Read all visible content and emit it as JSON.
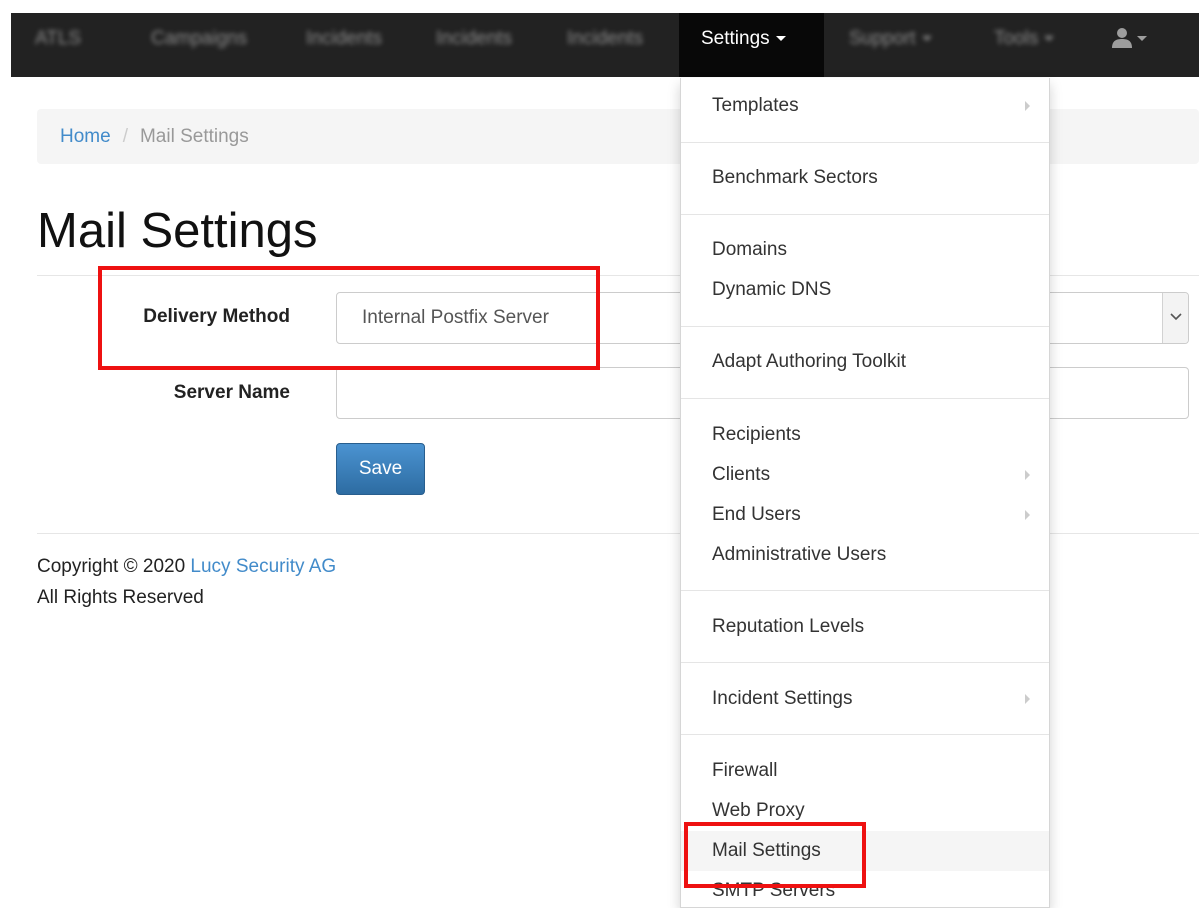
{
  "navbar": {
    "brand": "ATLS",
    "items": [
      {
        "label": "Campaigns"
      },
      {
        "label": "Incidents"
      },
      {
        "label": "Incidents"
      },
      {
        "label": "Incidents"
      }
    ],
    "active_menu": "Settings",
    "support_menu": "Support",
    "tools_menu": "Tools",
    "user_icon": "user-icon"
  },
  "breadcrumb": {
    "home": "Home",
    "separator": "/",
    "current": "Mail Settings"
  },
  "page": {
    "title": "Mail Settings"
  },
  "form": {
    "delivery_method_label": "Delivery Method",
    "delivery_method_value": "Internal Postfix Server",
    "server_name_label": "Server Name",
    "server_name_value": "",
    "save_label": "Save"
  },
  "footer": {
    "copyright_prefix": "Copyright © 2020",
    "company": "Lucy Security AG",
    "rights": "All Rights Reserved"
  },
  "settings_menu": {
    "groups": [
      [
        {
          "label": "Templates",
          "submenu": true
        }
      ],
      [
        {
          "label": "Benchmark Sectors",
          "submenu": false
        }
      ],
      [
        {
          "label": "Domains",
          "submenu": false
        },
        {
          "label": "Dynamic DNS",
          "submenu": false
        }
      ],
      [
        {
          "label": "Adapt Authoring Toolkit",
          "submenu": false
        }
      ],
      [
        {
          "label": "Recipients",
          "submenu": false
        },
        {
          "label": "Clients",
          "submenu": true
        },
        {
          "label": "End Users",
          "submenu": true
        },
        {
          "label": "Administrative Users",
          "submenu": false
        }
      ],
      [
        {
          "label": "Reputation Levels",
          "submenu": false
        }
      ],
      [
        {
          "label": "Incident Settings",
          "submenu": true
        }
      ],
      [
        {
          "label": "Firewall",
          "submenu": false
        },
        {
          "label": "Web Proxy",
          "submenu": false
        },
        {
          "label": "Mail Settings",
          "submenu": false
        },
        {
          "label": "SMTP Servers",
          "submenu": false
        }
      ]
    ],
    "hovered_item": "Mail Settings"
  },
  "colors": {
    "navbar_bg": "#222222",
    "link": "#428bca",
    "primary_button": "#3071a9",
    "annotation_red": "#ee1111"
  }
}
